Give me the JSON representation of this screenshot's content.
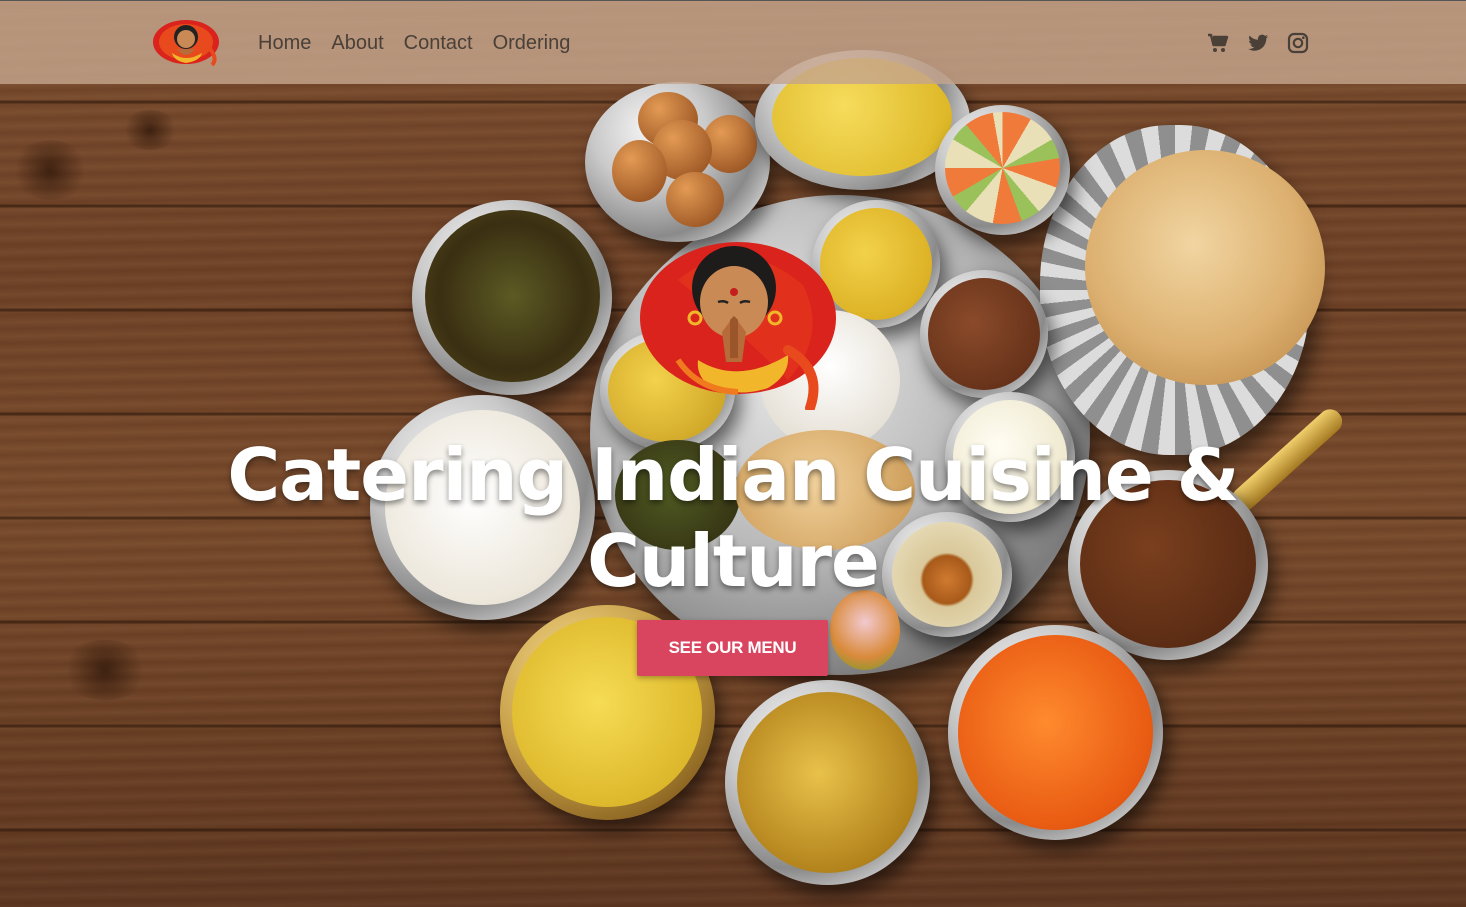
{
  "nav": {
    "logo_alt": "Indian woman namaste logo",
    "links": [
      "Home",
      "About",
      "Contact",
      "Ordering"
    ]
  },
  "social": {
    "icons": [
      "cart-icon",
      "twitter-icon",
      "instagram-icon"
    ]
  },
  "hero": {
    "title": "Catering Indian Cuisine & Culture",
    "cta_label": "SEE OUR MENU"
  },
  "colors": {
    "accent": "#d9455f",
    "header_bg": "#c4a58c",
    "title": "#ffffff",
    "nav_text": "#4a4038"
  }
}
